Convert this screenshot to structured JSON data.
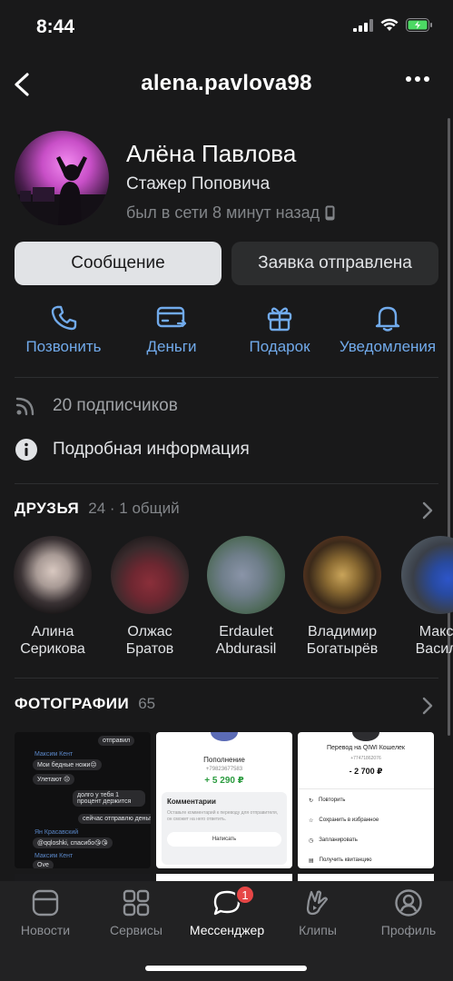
{
  "status_bar": {
    "time": "8:44"
  },
  "nav": {
    "title": "alena.pavlova98"
  },
  "profile": {
    "name": "Алёна Павлова",
    "status": "Стажер Поповича",
    "online": "был в сети 8 минут назад"
  },
  "buttons": {
    "message": "Сообщение",
    "request": "Заявка отправлена"
  },
  "actions": [
    {
      "label": "Позвонить",
      "icon": "phone-icon"
    },
    {
      "label": "Деньги",
      "icon": "money-card-icon"
    },
    {
      "label": "Подарок",
      "icon": "gift-icon"
    },
    {
      "label": "Уведомления",
      "icon": "bell-icon"
    }
  ],
  "info": {
    "followers": "20 подписчиков",
    "details": "Подробная информация"
  },
  "friends": {
    "title": "ДРУЗЬЯ",
    "count": "24 · 1 общий",
    "items": [
      {
        "line1": "Алина",
        "line2": "Серикова"
      },
      {
        "line1": "Олжас",
        "line2": "Братов"
      },
      {
        "line1": "Erdaulet",
        "line2": "Abdurasil"
      },
      {
        "line1": "Владимир",
        "line2": "Богатырёв"
      },
      {
        "line1": "Макси",
        "line2": "Василе"
      }
    ]
  },
  "photos": {
    "title": "ФОТОГРАФИИ",
    "count": "65",
    "chat": {
      "sent": "отправил",
      "sender1": "Максим Кент",
      "msg1": "Мои бедные ножи😔",
      "msg2": "Улетают 😔",
      "msg3": "долго у тебя 1 процент держится",
      "msg4": "сейчас отправлю деньги",
      "sender2": "Ян Красавский",
      "msg5": "@qqloshki, спасибо😘😘",
      "sender3": "Максим Кент",
      "msg6": "Ove"
    },
    "topup": {
      "title": "Пополнение",
      "phone": "+79823677583",
      "amount": "+ 5 290 ₽",
      "comments_title": "Комментарии",
      "comments_text": "Оставьте комментарий к переводу для отправителя, он сможет на него ответить.",
      "write": "Написать"
    },
    "transfer": {
      "title": "Перевод на QIWI Кошелек",
      "phone": "+77471862076",
      "amount": "- 2 700 ₽",
      "repeat": "Повторить",
      "save": "Сохранить в избранное",
      "schedule": "Запланировать",
      "receipt": "Получить квитанцию"
    }
  },
  "tabbar": {
    "items": [
      {
        "label": "Новости",
        "icon": "news-icon"
      },
      {
        "label": "Сервисы",
        "icon": "services-icon"
      },
      {
        "label": "Мессенджер",
        "icon": "messenger-icon",
        "badge": "1"
      },
      {
        "label": "Клипы",
        "icon": "clips-icon"
      },
      {
        "label": "Профиль",
        "icon": "profile-icon"
      }
    ]
  },
  "colors": {
    "background": "#19191a",
    "accent": "#71aaeb",
    "badge": "#e64646",
    "battery": "#4cd964"
  }
}
